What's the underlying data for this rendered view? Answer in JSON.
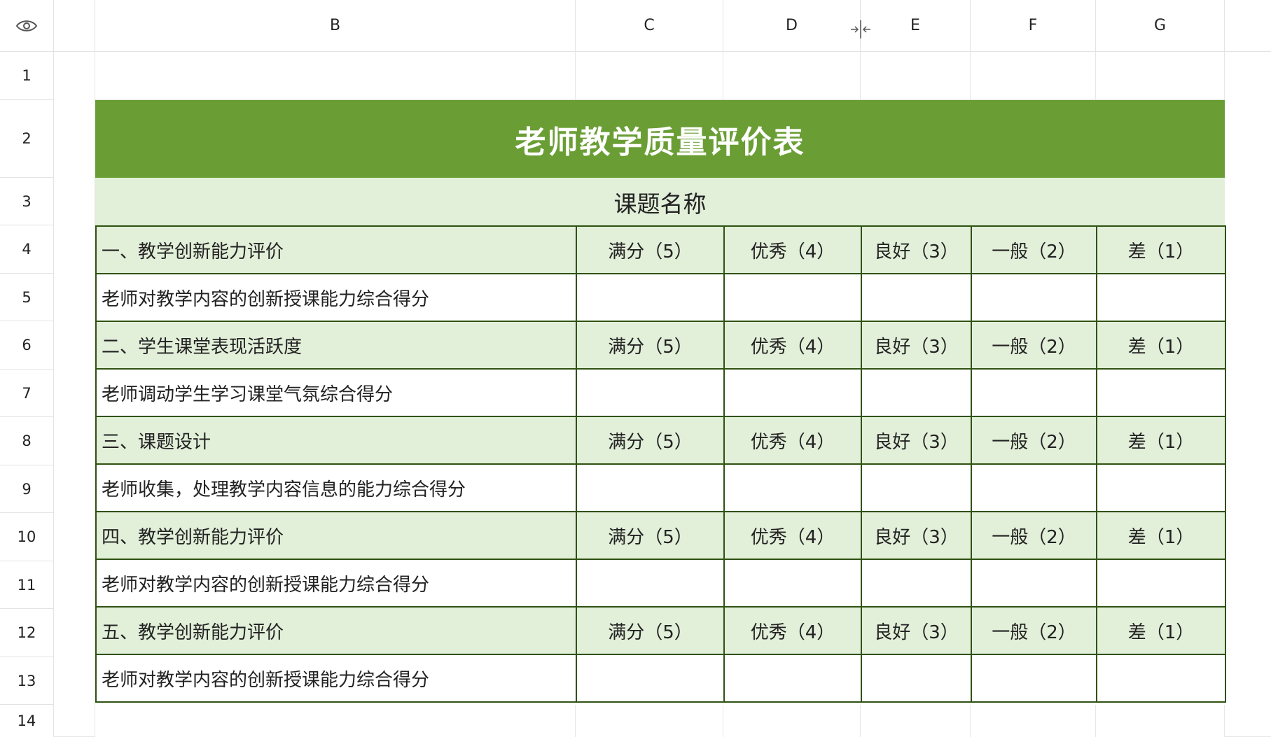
{
  "columns": [
    "B",
    "C",
    "D",
    "E",
    "F",
    "G"
  ],
  "rows": [
    "1",
    "2",
    "3",
    "4",
    "5",
    "6",
    "7",
    "8",
    "9",
    "10",
    "11",
    "12",
    "13",
    "14"
  ],
  "title": "老师教学质量评价表",
  "subtitle": "课题名称",
  "options": [
    "满分（5）",
    "优秀（4）",
    "良好（3）",
    "一般（2）",
    "差（1）"
  ],
  "sections": [
    {
      "header": "一、教学创新能力评价",
      "detail": "老师对教学内容的创新授课能力综合得分"
    },
    {
      "header": "二、学生课堂表现活跃度",
      "detail": "老师调动学生学习课堂气氛综合得分"
    },
    {
      "header": "三、课题设计",
      "detail": "老师收集，处理教学内容信息的能力综合得分"
    },
    {
      "header": "四、教学创新能力评价",
      "detail": "老师对教学内容的创新授课能力综合得分"
    },
    {
      "header": "五、教学创新能力评价",
      "detail": "老师对教学内容的创新授课能力综合得分"
    }
  ],
  "icons": {
    "visibility": "eye-icon",
    "column_resize": "column-resize-icon"
  },
  "colors": {
    "title_bg": "#6a9e35",
    "header_bg": "#e2efd9",
    "border": "#2f5212"
  }
}
